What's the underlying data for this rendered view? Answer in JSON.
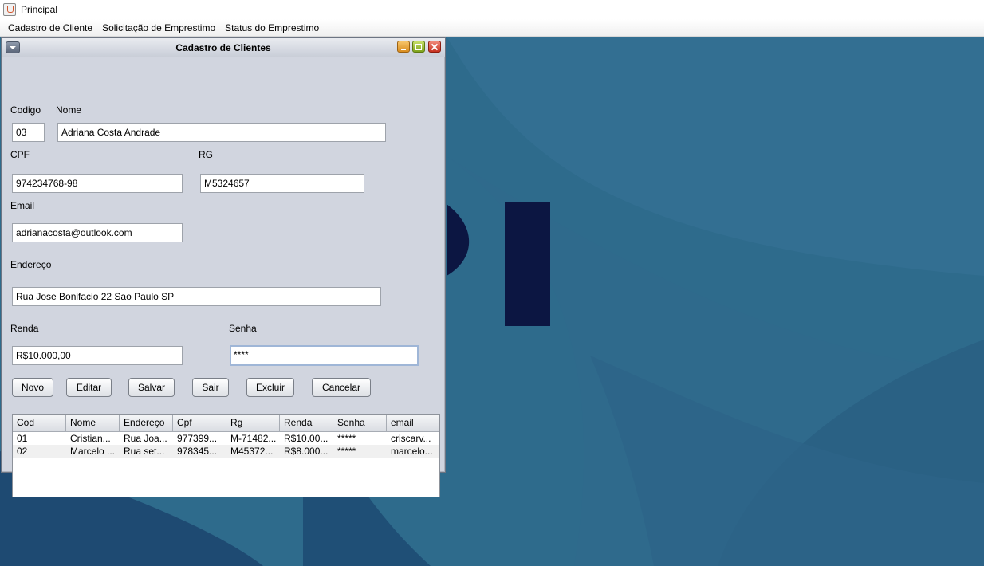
{
  "app": {
    "title": "Principal"
  },
  "menu": [
    "Cadastro de Cliente",
    "Solicitação de Emprestimo",
    "Status do Emprestimo"
  ],
  "colors": {
    "desktop": "#2a6386",
    "frame": "#d1d5df",
    "accent_dark": "#0c1642"
  },
  "dialog": {
    "title": "Cadastro de Clientes",
    "labels": {
      "codigo": "Codigo",
      "nome": "Nome",
      "cpf": "CPF",
      "rg": "RG",
      "email": "Email",
      "endereco": "Endereço",
      "renda": "Renda",
      "senha": "Senha"
    },
    "fields": {
      "codigo": "03",
      "nome": "Adriana Costa Andrade",
      "cpf": "974234768-98",
      "rg": "M5324657",
      "email": "adrianacosta@outlook.com",
      "endereco": "Rua Jose Bonifacio 22 Sao Paulo SP",
      "renda": "R$10.000,00",
      "senha": "****"
    },
    "buttons": {
      "novo": "Novo",
      "editar": "Editar",
      "salvar": "Salvar",
      "sair": "Sair",
      "excluir": "Excluir",
      "cancelar": "Cancelar"
    },
    "table": {
      "columns": [
        "Cod",
        "Nome",
        "Endereço",
        "Cpf",
        "Rg",
        "Renda",
        "Senha",
        "email"
      ],
      "rows": [
        [
          "01",
          "Cristian...",
          "Rua Joa...",
          "977399...",
          "M-71482...",
          "R$10.00...",
          "*****",
          "criscarv..."
        ],
        [
          "02",
          "Marcelo ...",
          "Rua set...",
          "978345...",
          "M45372...",
          "R$8.000...",
          "*****",
          "marcelo..."
        ]
      ]
    }
  }
}
